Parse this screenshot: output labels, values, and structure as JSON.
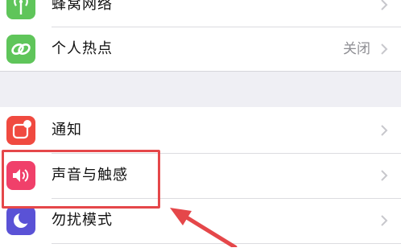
{
  "settings": {
    "group1": [
      {
        "label": "蜂窝网络",
        "value": "",
        "icon": "cellular-antenna-icon",
        "color": "#5fc55a"
      },
      {
        "label": "个人热点",
        "value": "关闭",
        "icon": "hotspot-chain-icon",
        "color": "#5fc55a"
      }
    ],
    "group2": [
      {
        "label": "通知",
        "value": "",
        "icon": "notification-icon",
        "color": "#f04a40"
      },
      {
        "label": "声音与触感",
        "value": "",
        "icon": "speaker-icon",
        "color": "#f0406a"
      },
      {
        "label": "勿扰模式",
        "value": "",
        "icon": "moon-icon",
        "color": "#5a52d6"
      }
    ]
  },
  "annotation": {
    "highlight_color": "#e5474a"
  }
}
